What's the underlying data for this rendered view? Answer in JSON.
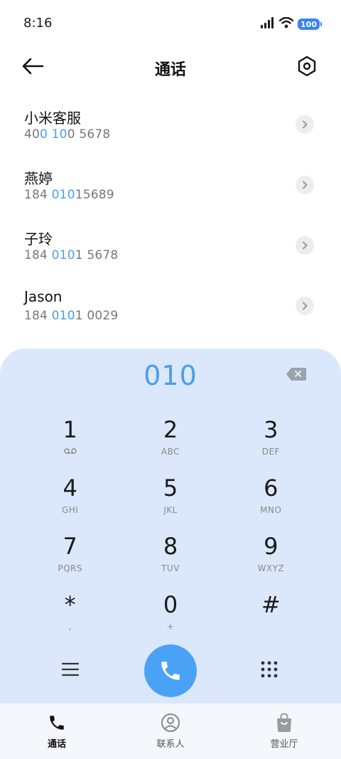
{
  "status_bar": {
    "time": "8:16",
    "battery": "100",
    "icons": [
      "signal-icon",
      "wifi-icon",
      "battery-icon"
    ]
  },
  "header": {
    "title": "通话",
    "back_icon": "arrow-left-icon",
    "settings_icon": "hexagon-gear-icon"
  },
  "contacts": [
    {
      "name": "小米客服",
      "number_parts": [
        "40",
        "0 10",
        "0 5678"
      ]
    },
    {
      "name": "燕婷",
      "number_parts": [
        "184 ",
        "010",
        "15689"
      ]
    },
    {
      "name": "子玲",
      "number_parts": [
        "184 ",
        "010",
        "1 5678"
      ]
    },
    {
      "name": "Jason",
      "number_parts": [
        "184 ",
        "010",
        "1 0029"
      ]
    }
  ],
  "dialer": {
    "input": "010",
    "keys": [
      {
        "digit": "1",
        "letters": "voicemail-icon"
      },
      {
        "digit": "2",
        "letters": "ABC"
      },
      {
        "digit": "3",
        "letters": "DEF"
      },
      {
        "digit": "4",
        "letters": "GHI"
      },
      {
        "digit": "5",
        "letters": "JKL"
      },
      {
        "digit": "6",
        "letters": "MNO"
      },
      {
        "digit": "7",
        "letters": "PQRS"
      },
      {
        "digit": "8",
        "letters": "TUV"
      },
      {
        "digit": "9",
        "letters": "WXYZ"
      },
      {
        "digit": "*",
        "letters": ","
      },
      {
        "digit": "0",
        "letters": "+"
      },
      {
        "digit": "#",
        "letters": ""
      }
    ]
  },
  "bottom_nav": [
    {
      "label": "通话",
      "icon": "phone-icon",
      "active": true
    },
    {
      "label": "联系人",
      "icon": "person-icon",
      "active": false
    },
    {
      "label": "营业厅",
      "icon": "shopping-bag-icon",
      "active": false
    }
  ],
  "colors": {
    "accent": "#4a9cef",
    "dialer_bg": "#dbe8fb",
    "call_button": "#4aa2f7"
  }
}
